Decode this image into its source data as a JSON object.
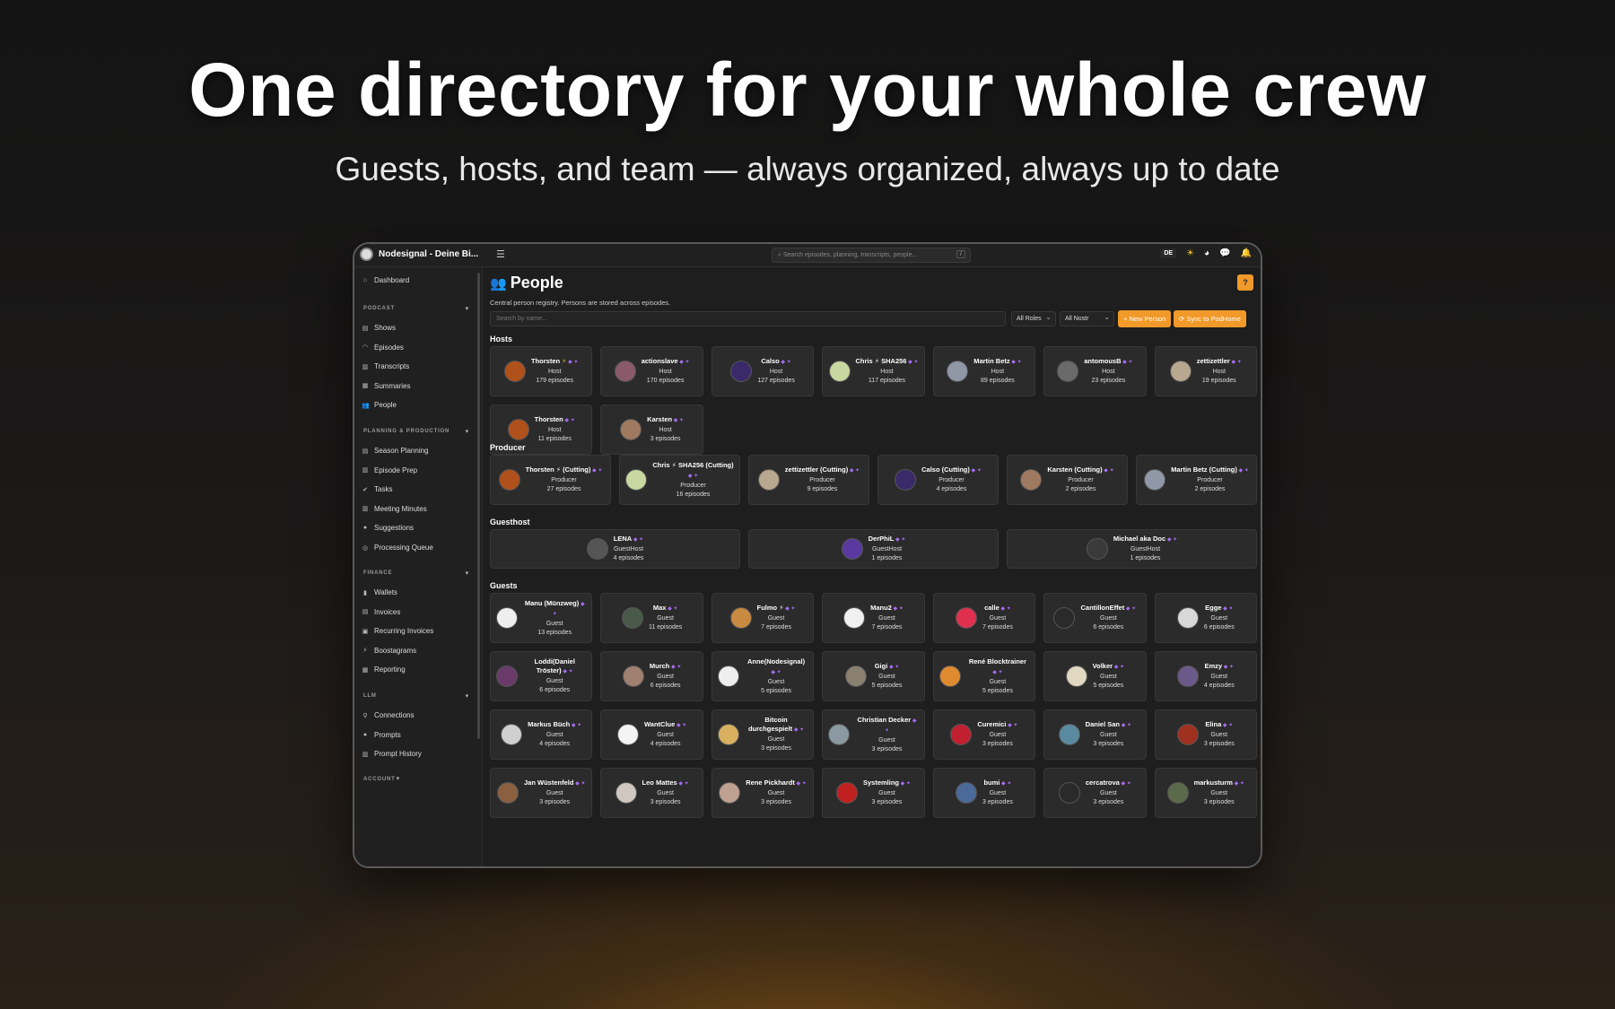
{
  "hero": {
    "title": "One directory for your whole crew",
    "subtitle": "Guests, hosts, and team — always organized, always up to date"
  },
  "topbar": {
    "brand": "Nodesignal - Deine Bi...",
    "search_placeholder": "Search episodes, planning, transcripts, people...",
    "search_shortcut": "/",
    "language": "DE"
  },
  "sidebar": {
    "dashboard": "Dashboard",
    "sections": [
      {
        "heading": "PODCAST",
        "items": [
          "Shows",
          "Episodes",
          "Transcripts",
          "Summaries",
          "People"
        ]
      },
      {
        "heading": "PLANNING & PRODUCTION",
        "items": [
          "Season Planning",
          "Episode Prep",
          "Tasks",
          "Meeting Minutes",
          "Suggestions",
          "Processing Queue"
        ]
      },
      {
        "heading": "FINANCE",
        "items": [
          "Wallets",
          "Invoices",
          "Recurring Invoices",
          "Boostagrams",
          "Reporting"
        ]
      },
      {
        "heading": "LLM",
        "items": [
          "Connections",
          "Prompts",
          "Prompt History"
        ]
      },
      {
        "heading": "ACCOUNT",
        "items": []
      }
    ]
  },
  "page": {
    "title": "People",
    "help": "?",
    "description": "Central person registry. Persons are stored across episodes.",
    "search_placeholder": "Search by name...",
    "filter_roles": "All Roles",
    "filter_nostr": "All Nostr",
    "new_person": "+ New Person",
    "sync": "⟳ Sync to PodHome"
  },
  "sections": [
    {
      "title": "Hosts",
      "people": [
        {
          "name": "Thorsten",
          "bolt": true,
          "role": "Host",
          "episodes": "179 episodes",
          "color": "#b0501a"
        },
        {
          "name": "actionslave",
          "bolt": false,
          "role": "Host",
          "episodes": "170 episodes",
          "color": "#8a5a6a"
        },
        {
          "name": "Calso",
          "bolt": false,
          "role": "Host",
          "episodes": "127 episodes",
          "color": "#3a2a6a"
        },
        {
          "name": "Chris ⚡ SHA256",
          "bolt": false,
          "role": "Host",
          "episodes": "117 episodes",
          "color": "#c8d8a0"
        },
        {
          "name": "Martin Betz",
          "bolt": false,
          "role": "Host",
          "episodes": "89 episodes",
          "color": "#9098a8"
        },
        {
          "name": "antomousB",
          "bolt": false,
          "role": "Host",
          "episodes": "23 episodes",
          "color": "#6a6a6a"
        },
        {
          "name": "zettizettler",
          "bolt": false,
          "role": "Host",
          "episodes": "19 episodes",
          "color": "#b8a890"
        },
        {
          "name": "Thorsten",
          "bolt": false,
          "role": "Host",
          "episodes": "11 episodes",
          "color": "#b0501a"
        },
        {
          "name": "Karsten",
          "bolt": false,
          "role": "Host",
          "episodes": "3 episodes",
          "color": "#a07a60"
        }
      ]
    },
    {
      "title": "Producer",
      "people": [
        {
          "name": "Thorsten ⚡ (Cutting)",
          "bolt": false,
          "role": "Producer",
          "episodes": "27 episodes",
          "color": "#b0501a"
        },
        {
          "name": "Chris ⚡ SHA256 (Cutting)",
          "bolt": false,
          "role": "Producer",
          "episodes": "16 episodes",
          "color": "#c8d8a0"
        },
        {
          "name": "zettizettler (Cutting)",
          "bolt": false,
          "role": "Producer",
          "episodes": "9 episodes",
          "color": "#b8a890"
        },
        {
          "name": "Calso (Cutting)",
          "bolt": false,
          "role": "Producer",
          "episodes": "4 episodes",
          "color": "#3a2a6a"
        },
        {
          "name": "Karsten (Cutting)",
          "bolt": false,
          "role": "Producer",
          "episodes": "2 episodes",
          "color": "#a07a60"
        },
        {
          "name": "Martin Betz (Cutting)",
          "bolt": false,
          "role": "Producer",
          "episodes": "2 episodes",
          "color": "#9098a8"
        }
      ]
    },
    {
      "title": "Guesthost",
      "people": [
        {
          "name": "LENA",
          "bolt": false,
          "role": "GuestHost",
          "episodes": "4 episodes",
          "color": "#555555"
        },
        {
          "name": "DerPhiL",
          "bolt": false,
          "role": "GuestHost",
          "episodes": "1 episodes",
          "color": "#5a3aa0"
        },
        {
          "name": "Michael aka Doc",
          "bolt": false,
          "role": "GuestHost",
          "episodes": "1 episodes",
          "color": "#3a3a3a"
        }
      ]
    },
    {
      "title": "Guests",
      "people": [
        {
          "name": "Manu (Münzweg)",
          "bolt": false,
          "role": "Guest",
          "episodes": "13 episodes",
          "color": "#eeeeee"
        },
        {
          "name": "Max",
          "bolt": false,
          "role": "Guest",
          "episodes": "11 episodes",
          "color": "#4a5a4a"
        },
        {
          "name": "Fulmo ⚡",
          "bolt": false,
          "role": "Guest",
          "episodes": "7 episodes",
          "color": "#c88a40"
        },
        {
          "name": "Manu2",
          "bolt": false,
          "role": "Guest",
          "episodes": "7 episodes",
          "color": "#f0f0f0"
        },
        {
          "name": "calle",
          "bolt": false,
          "role": "Guest",
          "episodes": "7 episodes",
          "color": "#e03050"
        },
        {
          "name": "CantillonEffet",
          "bolt": false,
          "role": "Guest",
          "episodes": "6 episodes",
          "color": "#2a2a2a"
        },
        {
          "name": "Egge",
          "bolt": false,
          "role": "Guest",
          "episodes": "6 episodes",
          "color": "#d8d8d8"
        },
        {
          "name": "Loddi(Daniel Tröster)",
          "bolt": false,
          "role": "Guest",
          "episodes": "6 episodes",
          "color": "#6a3a6a"
        },
        {
          "name": "Murch",
          "bolt": false,
          "role": "Guest",
          "episodes": "6 episodes",
          "color": "#a08070"
        },
        {
          "name": "Anne(Nodesignal)",
          "bolt": false,
          "role": "Guest",
          "episodes": "5 episodes",
          "color": "#eeeeee"
        },
        {
          "name": "Gigi",
          "bolt": false,
          "role": "Guest",
          "episodes": "5 episodes",
          "color": "#8a8070"
        },
        {
          "name": "René Blocktrainer",
          "bolt": false,
          "role": "Guest",
          "episodes": "5 episodes",
          "color": "#e08a30"
        },
        {
          "name": "Volker",
          "bolt": false,
          "role": "Guest",
          "episodes": "5 episodes",
          "color": "#e0d8c0"
        },
        {
          "name": "Emzy",
          "bolt": false,
          "role": "Guest",
          "episodes": "4 episodes",
          "color": "#6a5a8a"
        },
        {
          "name": "Markus Büch",
          "bolt": false,
          "role": "Guest",
          "episodes": "4 episodes",
          "color": "#d0d0d0"
        },
        {
          "name": "WantClue",
          "bolt": false,
          "role": "Guest",
          "episodes": "4 episodes",
          "color": "#f4f4f4"
        },
        {
          "name": "Bitcoin durchgespielt",
          "bolt": false,
          "role": "Guest",
          "episodes": "3 episodes",
          "color": "#d8b060"
        },
        {
          "name": "Christian Decker",
          "bolt": false,
          "role": "Guest",
          "episodes": "3 episodes",
          "color": "#8a9aa0"
        },
        {
          "name": "Curemici",
          "bolt": false,
          "role": "Guest",
          "episodes": "3 episodes",
          "color": "#c02030"
        },
        {
          "name": "Daniel San",
          "bolt": false,
          "role": "Guest",
          "episodes": "3 episodes",
          "color": "#5a8aa0"
        },
        {
          "name": "Elina",
          "bolt": false,
          "role": "Guest",
          "episodes": "3 episodes",
          "color": "#a03020"
        },
        {
          "name": "Jan Wüstenfeld",
          "bolt": false,
          "role": "Guest",
          "episodes": "3 episodes",
          "color": "#8a6040"
        },
        {
          "name": "Leo Mattes",
          "bolt": false,
          "role": "Guest",
          "episodes": "3 episodes",
          "color": "#d0c8c0"
        },
        {
          "name": "Rene Pickhardt",
          "bolt": false,
          "role": "Guest",
          "episodes": "3 episodes",
          "color": "#c0a090"
        },
        {
          "name": "Systemling",
          "bolt": false,
          "role": "Guest",
          "episodes": "3 episodes",
          "color": "#c02020"
        },
        {
          "name": "bumi",
          "bolt": false,
          "role": "Guest",
          "episodes": "3 episodes",
          "color": "#4a6a9a"
        },
        {
          "name": "cercatrova",
          "bolt": false,
          "role": "Guest",
          "episodes": "3 episodes",
          "color": "#2a2a2a"
        },
        {
          "name": "markusturm",
          "bolt": false,
          "role": "Guest",
          "episodes": "3 episodes",
          "color": "#5a6a4a"
        }
      ]
    }
  ]
}
